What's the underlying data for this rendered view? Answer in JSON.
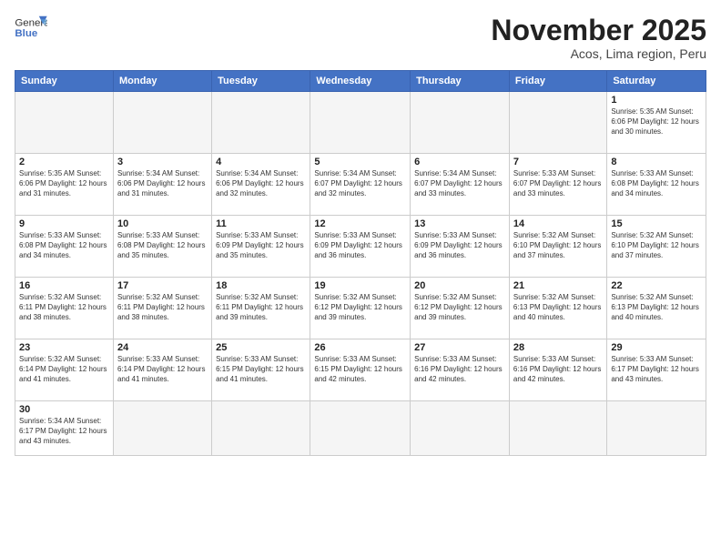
{
  "header": {
    "logo_general": "General",
    "logo_blue": "Blue",
    "month": "November 2025",
    "location": "Acos, Lima region, Peru"
  },
  "weekdays": [
    "Sunday",
    "Monday",
    "Tuesday",
    "Wednesday",
    "Thursday",
    "Friday",
    "Saturday"
  ],
  "weeks": [
    [
      {
        "day": "",
        "info": ""
      },
      {
        "day": "",
        "info": ""
      },
      {
        "day": "",
        "info": ""
      },
      {
        "day": "",
        "info": ""
      },
      {
        "day": "",
        "info": ""
      },
      {
        "day": "",
        "info": ""
      },
      {
        "day": "1",
        "info": "Sunrise: 5:35 AM\nSunset: 6:06 PM\nDaylight: 12 hours\nand 30 minutes."
      }
    ],
    [
      {
        "day": "2",
        "info": "Sunrise: 5:35 AM\nSunset: 6:06 PM\nDaylight: 12 hours\nand 31 minutes."
      },
      {
        "day": "3",
        "info": "Sunrise: 5:34 AM\nSunset: 6:06 PM\nDaylight: 12 hours\nand 31 minutes."
      },
      {
        "day": "4",
        "info": "Sunrise: 5:34 AM\nSunset: 6:06 PM\nDaylight: 12 hours\nand 32 minutes."
      },
      {
        "day": "5",
        "info": "Sunrise: 5:34 AM\nSunset: 6:07 PM\nDaylight: 12 hours\nand 32 minutes."
      },
      {
        "day": "6",
        "info": "Sunrise: 5:34 AM\nSunset: 6:07 PM\nDaylight: 12 hours\nand 33 minutes."
      },
      {
        "day": "7",
        "info": "Sunrise: 5:33 AM\nSunset: 6:07 PM\nDaylight: 12 hours\nand 33 minutes."
      },
      {
        "day": "8",
        "info": "Sunrise: 5:33 AM\nSunset: 6:08 PM\nDaylight: 12 hours\nand 34 minutes."
      }
    ],
    [
      {
        "day": "9",
        "info": "Sunrise: 5:33 AM\nSunset: 6:08 PM\nDaylight: 12 hours\nand 34 minutes."
      },
      {
        "day": "10",
        "info": "Sunrise: 5:33 AM\nSunset: 6:08 PM\nDaylight: 12 hours\nand 35 minutes."
      },
      {
        "day": "11",
        "info": "Sunrise: 5:33 AM\nSunset: 6:09 PM\nDaylight: 12 hours\nand 35 minutes."
      },
      {
        "day": "12",
        "info": "Sunrise: 5:33 AM\nSunset: 6:09 PM\nDaylight: 12 hours\nand 36 minutes."
      },
      {
        "day": "13",
        "info": "Sunrise: 5:33 AM\nSunset: 6:09 PM\nDaylight: 12 hours\nand 36 minutes."
      },
      {
        "day": "14",
        "info": "Sunrise: 5:32 AM\nSunset: 6:10 PM\nDaylight: 12 hours\nand 37 minutes."
      },
      {
        "day": "15",
        "info": "Sunrise: 5:32 AM\nSunset: 6:10 PM\nDaylight: 12 hours\nand 37 minutes."
      }
    ],
    [
      {
        "day": "16",
        "info": "Sunrise: 5:32 AM\nSunset: 6:11 PM\nDaylight: 12 hours\nand 38 minutes."
      },
      {
        "day": "17",
        "info": "Sunrise: 5:32 AM\nSunset: 6:11 PM\nDaylight: 12 hours\nand 38 minutes."
      },
      {
        "day": "18",
        "info": "Sunrise: 5:32 AM\nSunset: 6:11 PM\nDaylight: 12 hours\nand 39 minutes."
      },
      {
        "day": "19",
        "info": "Sunrise: 5:32 AM\nSunset: 6:12 PM\nDaylight: 12 hours\nand 39 minutes."
      },
      {
        "day": "20",
        "info": "Sunrise: 5:32 AM\nSunset: 6:12 PM\nDaylight: 12 hours\nand 39 minutes."
      },
      {
        "day": "21",
        "info": "Sunrise: 5:32 AM\nSunset: 6:13 PM\nDaylight: 12 hours\nand 40 minutes."
      },
      {
        "day": "22",
        "info": "Sunrise: 5:32 AM\nSunset: 6:13 PM\nDaylight: 12 hours\nand 40 minutes."
      }
    ],
    [
      {
        "day": "23",
        "info": "Sunrise: 5:32 AM\nSunset: 6:14 PM\nDaylight: 12 hours\nand 41 minutes."
      },
      {
        "day": "24",
        "info": "Sunrise: 5:33 AM\nSunset: 6:14 PM\nDaylight: 12 hours\nand 41 minutes."
      },
      {
        "day": "25",
        "info": "Sunrise: 5:33 AM\nSunset: 6:15 PM\nDaylight: 12 hours\nand 41 minutes."
      },
      {
        "day": "26",
        "info": "Sunrise: 5:33 AM\nSunset: 6:15 PM\nDaylight: 12 hours\nand 42 minutes."
      },
      {
        "day": "27",
        "info": "Sunrise: 5:33 AM\nSunset: 6:16 PM\nDaylight: 12 hours\nand 42 minutes."
      },
      {
        "day": "28",
        "info": "Sunrise: 5:33 AM\nSunset: 6:16 PM\nDaylight: 12 hours\nand 42 minutes."
      },
      {
        "day": "29",
        "info": "Sunrise: 5:33 AM\nSunset: 6:17 PM\nDaylight: 12 hours\nand 43 minutes."
      }
    ],
    [
      {
        "day": "30",
        "info": "Sunrise: 5:34 AM\nSunset: 6:17 PM\nDaylight: 12 hours\nand 43 minutes."
      },
      {
        "day": "",
        "info": ""
      },
      {
        "day": "",
        "info": ""
      },
      {
        "day": "",
        "info": ""
      },
      {
        "day": "",
        "info": ""
      },
      {
        "day": "",
        "info": ""
      },
      {
        "day": "",
        "info": ""
      }
    ]
  ]
}
